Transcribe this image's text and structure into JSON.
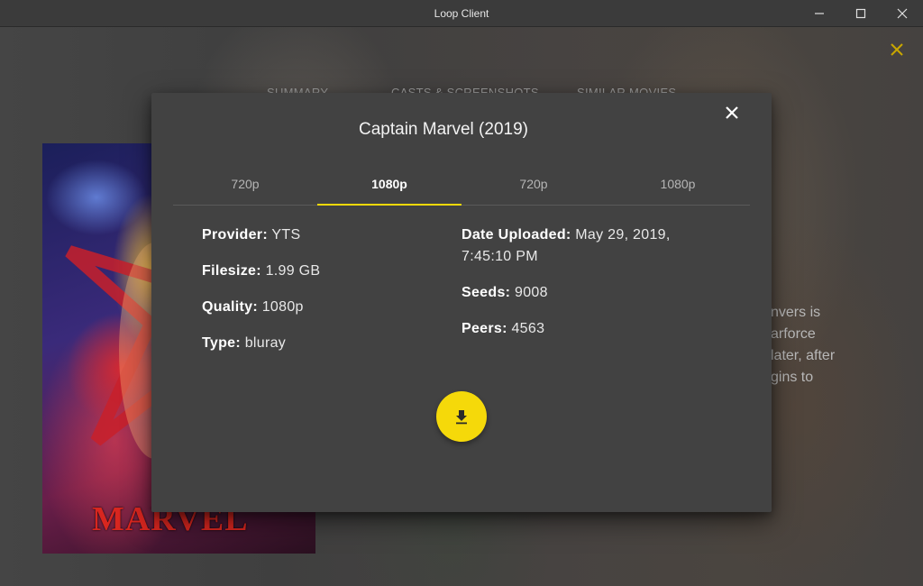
{
  "window": {
    "title": "Loop Client"
  },
  "background": {
    "tabs": [
      "SUMMARY",
      "CASTS & SCREENSHOTS",
      "SIMILAR MOVIES"
    ],
    "poster_text": "MARVEL",
    "description_fragments": [
      "nvers is",
      "arforce",
      "later, after",
      "gins to"
    ]
  },
  "modal": {
    "title": "Captain Marvel (2019)",
    "tabs": [
      {
        "label": "720p",
        "active": false
      },
      {
        "label": "1080p",
        "active": true
      },
      {
        "label": "720p",
        "active": false
      },
      {
        "label": "1080p",
        "active": false
      }
    ],
    "details_left": [
      {
        "label": "Provider:",
        "value": "YTS"
      },
      {
        "label": "Filesize:",
        "value": "1.99 GB"
      },
      {
        "label": "Quality:",
        "value": "1080p"
      },
      {
        "label": "Type:",
        "value": "bluray"
      }
    ],
    "details_right": [
      {
        "label": "Date Uploaded:",
        "value": "May 29, 2019, 7:45:10 PM"
      },
      {
        "label": "Seeds:",
        "value": "9008"
      },
      {
        "label": "Peers:",
        "value": "4563"
      }
    ]
  },
  "colors": {
    "accent": "#f5d90a",
    "modal_bg": "#424242",
    "titlebar_bg": "#3b3b3b"
  },
  "icons": {
    "minimize": "minimize-icon",
    "maximize": "maximize-icon",
    "close": "close-icon",
    "download": "download-icon"
  }
}
